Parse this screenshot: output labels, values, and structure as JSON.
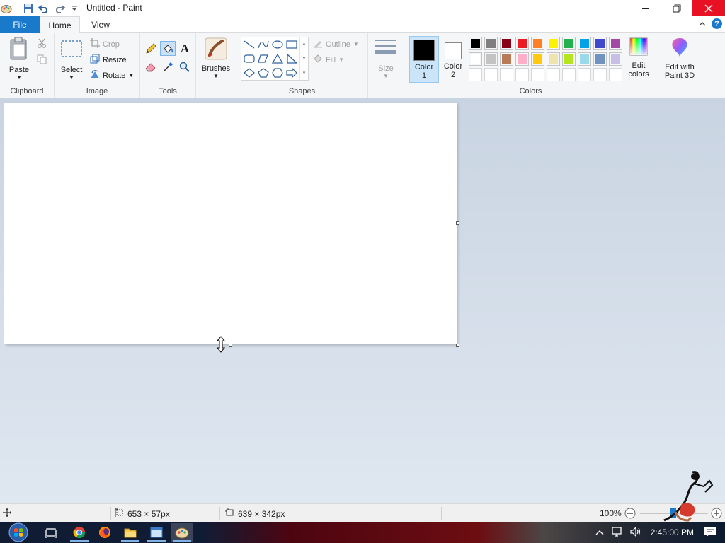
{
  "window": {
    "title": "Untitled - Paint",
    "controls": {
      "minimize": "—",
      "maximize": "❐",
      "close": "✕"
    }
  },
  "tabs": [
    {
      "label": "File"
    },
    {
      "label": "Home"
    },
    {
      "label": "View"
    }
  ],
  "help": {
    "glyph": "?"
  },
  "ribbon": {
    "clipboard": {
      "label": "Clipboard",
      "paste": "Paste"
    },
    "image": {
      "label": "Image",
      "select": "Select",
      "crop": "Crop",
      "resize": "Resize",
      "rotate": "Rotate"
    },
    "tools": {
      "label": "Tools"
    },
    "brushes": {
      "label": "Brushes"
    },
    "shapes": {
      "label": "Shapes",
      "outline": "Outline",
      "fill": "Fill"
    },
    "size": {
      "label": "Size"
    },
    "colors": {
      "label": "Colors",
      "color1_label": "Color",
      "color1_num": "1",
      "color2_label": "Color",
      "color2_num": "2",
      "color1": "#000000",
      "color2": "#ffffff",
      "palette_row1": [
        "#000000",
        "#7f7f7f",
        "#880015",
        "#ed1c24",
        "#ff7f27",
        "#fff200",
        "#22b14c",
        "#00a2e8",
        "#3f48cc",
        "#a349a4"
      ],
      "palette_row2": [
        "#ffffff",
        "#c3c3c3",
        "#b97a57",
        "#ffaec9",
        "#ffc90e",
        "#efe4b0",
        "#b5e61d",
        "#99d9ea",
        "#7092be",
        "#c8bfe7"
      ],
      "palette_row3": [
        "#ffffff",
        "#ffffff",
        "#ffffff",
        "#ffffff",
        "#ffffff",
        "#ffffff",
        "#ffffff",
        "#ffffff",
        "#ffffff",
        "#ffffff"
      ],
      "edit_colors_line1": "Edit",
      "edit_colors_line2": "colors",
      "paint3d_line1": "Edit with",
      "paint3d_line2": "Paint 3D"
    }
  },
  "status": {
    "cursor_pos": "653 × 57px",
    "canvas_size": "639 × 342px",
    "zoom": "100%"
  },
  "taskbar": {
    "clock": "2:45:00 PM"
  }
}
